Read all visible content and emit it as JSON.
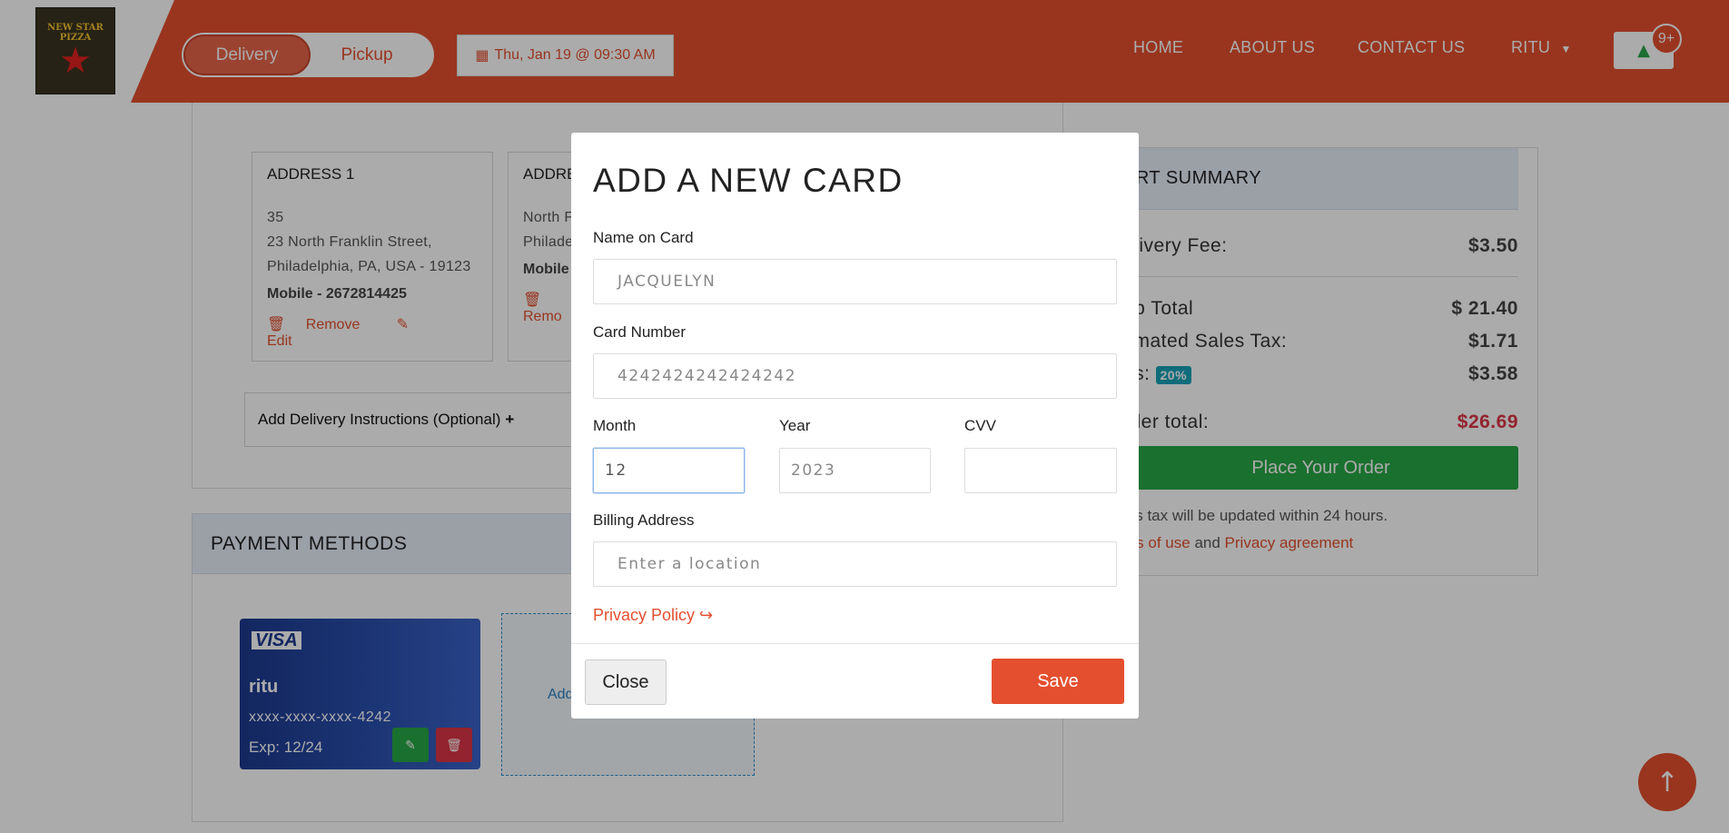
{
  "header": {
    "logo_text": "NEW STAR PIZZA",
    "delivery_label": "Delivery",
    "pickup_label": "Pickup",
    "schedule_label": "Thu, Jan 19 @ 09:30 AM",
    "nav": [
      "HOME",
      "ABOUT US",
      "CONTACT US",
      "RITU"
    ],
    "cart_count": "9+",
    "accent": "#e44f2f"
  },
  "addresses": [
    {
      "title": "ADDRESS 1",
      "line1": "35",
      "line2": "23 North Franklin Street,",
      "line3": "Philadelphia, PA, USA - 19123",
      "mobile": "Mobile - 2672814425",
      "remove": "Remove",
      "edit": "Edit"
    },
    {
      "title": "ADDRE",
      "line1": "North F",
      "line2": "Philade",
      "mobile": "Mobile",
      "remove": "Remo"
    }
  ],
  "delivery_instructions": "Add Delivery Instructions (Optional)",
  "payment": {
    "heading": "PAYMENT METHODS",
    "card": {
      "brand": "VISA",
      "name": "ritu",
      "number": "xxxx-xxxx-xxxx-4242",
      "expiry": "Exp: 12/24"
    },
    "add_card": "Add"
  },
  "summary": {
    "heading": "ART SUMMARY",
    "delivery_fee_label": "elivery Fee:",
    "delivery_fee": "$3.50",
    "subtotal_label": "ub Total",
    "subtotal": "$ 21.40",
    "tax_label": "timated Sales Tax:",
    "tax": "$1.71",
    "tips_label": "ps:",
    "tips_pct": "20%",
    "tips": "$3.58",
    "total_label": "rder total:",
    "total": "$26.69",
    "place_order": "Place Your Order",
    "note": "les tax will be updated within 24 hours.",
    "terms": "ms of use",
    "and": "and",
    "privacy_agreement": "Privacy agreement"
  },
  "modal": {
    "title": "ADD A NEW CARD",
    "name_label": "Name on Card",
    "name_value": "JACQUELYN",
    "number_label": "Card Number",
    "number_value": "4242424242424242",
    "month_label": "Month",
    "month_value": "12",
    "year_label": "Year",
    "year_value": "2023",
    "cvv_label": "CVV",
    "cvv_value": "",
    "billing_label": "Billing Address",
    "billing_placeholder": "Enter a location",
    "privacy_policy": "Privacy Policy",
    "close": "Close",
    "save": "Save"
  }
}
